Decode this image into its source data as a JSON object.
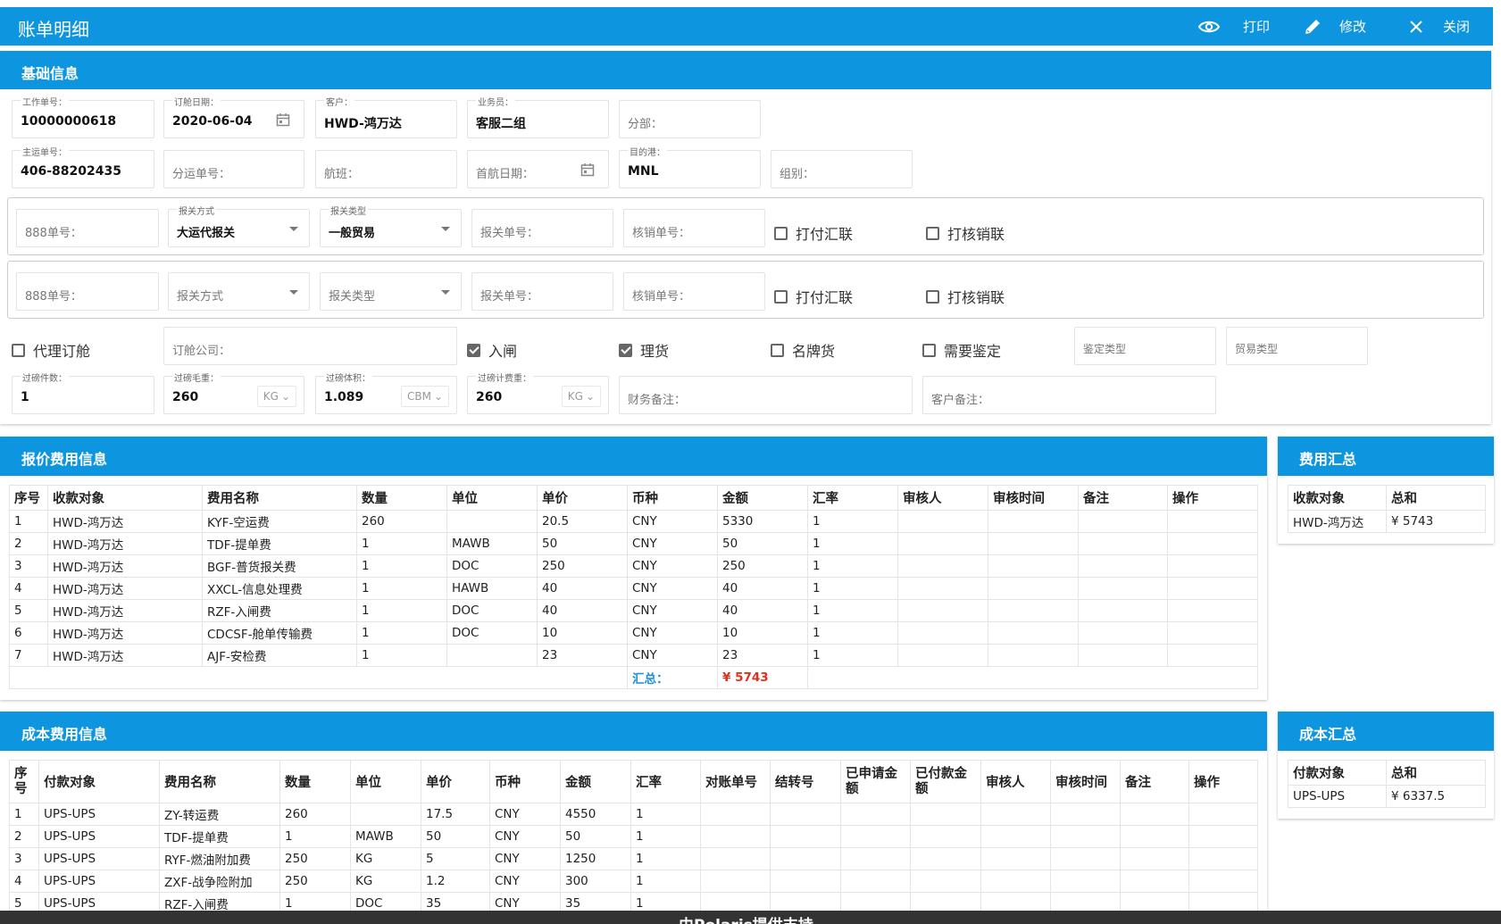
{
  "window": {
    "title": "账单明细",
    "buttons": {
      "print": "打印",
      "edit": "修改",
      "close": "关闭"
    }
  },
  "basic": {
    "heading": "基础信息",
    "work_no": {
      "label": "工作单号：",
      "value": "10000000618"
    },
    "booking_date": {
      "label": "订舱日期：",
      "value": "2020-06-04"
    },
    "customer": {
      "label": "客户：",
      "value": "HWD-鸿万达"
    },
    "salesman": {
      "label": "业务员：",
      "value": "客服二组"
    },
    "branch": {
      "placeholder": "分部："
    },
    "master_no": {
      "label": "主运单号：",
      "value": "406-88202435"
    },
    "sub_no": {
      "placeholder": "分运单号："
    },
    "flight": {
      "placeholder": "航班："
    },
    "first_flight_date": {
      "placeholder": "首航日期："
    },
    "destination": {
      "label": "目的港：",
      "value": "MNL"
    },
    "group": {
      "placeholder": "组别："
    },
    "customs_rows": [
      {
        "no888": "888单号：",
        "method_label": "报关方式",
        "method": "大运代报关",
        "type_label": "报关类型",
        "type": "一般贸易",
        "decl_no": "报关单号：",
        "verify_no": "核销单号：",
        "print_pay": "打付汇联",
        "print_verify": "打核销联"
      },
      {
        "no888": "888单号：",
        "method_placeholder": "报关方式",
        "type_placeholder": "报关类型",
        "decl_no": "报关单号：",
        "verify_no": "核销单号：",
        "print_pay": "打付汇联",
        "print_verify": "打核销联"
      }
    ],
    "agent_booking": "代理订舱",
    "booking_company": "订舱公司：",
    "gate_in": "入闸",
    "sorting": "理货",
    "brand_goods": "名牌货",
    "need_inspection": "需要鉴定",
    "inspection_type": "鉴定类型",
    "trade_type": "贸易类型",
    "pieces": {
      "label": "过磅件数：",
      "value": "1"
    },
    "gross_weight": {
      "label": "过磅毛重：",
      "value": "260",
      "unit": "KG"
    },
    "volume": {
      "label": "过磅体积：",
      "value": "1.089",
      "unit": "CBM"
    },
    "charge_weight": {
      "label": "过磅计费重：",
      "value": "260",
      "unit": "KG"
    },
    "finance_note": "财务备注：",
    "customer_note": "客户备注："
  },
  "quote": {
    "heading": "报价费用信息",
    "columns": [
      "序号",
      "收款对象",
      "费用名称",
      "数量",
      "单位",
      "单价",
      "币种",
      "金额",
      "汇率",
      "审核人",
      "审核时间",
      "备注",
      "操作"
    ],
    "rows": [
      [
        "1",
        "HWD-鸿万达",
        "KYF-空运费",
        "260",
        "",
        "20.5",
        "CNY",
        "5330",
        "1",
        "",
        "",
        "",
        ""
      ],
      [
        "2",
        "HWD-鸿万达",
        "TDF-提单费",
        "1",
        "MAWB",
        "50",
        "CNY",
        "50",
        "1",
        "",
        "",
        "",
        ""
      ],
      [
        "3",
        "HWD-鸿万达",
        "BGF-普货报关费",
        "1",
        "DOC",
        "250",
        "CNY",
        "250",
        "1",
        "",
        "",
        "",
        ""
      ],
      [
        "4",
        "HWD-鸿万达",
        "XXCL-信息处理费",
        "1",
        "HAWB",
        "40",
        "CNY",
        "40",
        "1",
        "",
        "",
        "",
        ""
      ],
      [
        "5",
        "HWD-鸿万达",
        "RZF-入闸费",
        "1",
        "DOC",
        "40",
        "CNY",
        "40",
        "1",
        "",
        "",
        "",
        ""
      ],
      [
        "6",
        "HWD-鸿万达",
        "CDCSF-舱单传输费",
        "1",
        "DOC",
        "10",
        "CNY",
        "10",
        "1",
        "",
        "",
        "",
        ""
      ],
      [
        "7",
        "HWD-鸿万达",
        "AJF-安检费",
        "1",
        "",
        "23",
        "CNY",
        "23",
        "1",
        "",
        "",
        "",
        ""
      ]
    ],
    "total_label": "汇总：",
    "total_value": "¥ 5743"
  },
  "fee_summary": {
    "heading": "费用汇总",
    "columns": [
      "收款对象",
      "总和"
    ],
    "rows": [
      [
        "HWD-鸿万达",
        "¥ 5743"
      ]
    ]
  },
  "cost": {
    "heading": "成本费用信息",
    "columns": [
      "序号",
      "付款对象",
      "费用名称",
      "数量",
      "单位",
      "单价",
      "币种",
      "金额",
      "汇率",
      "对账单号",
      "结转号",
      "已申请金额",
      "已付款金额",
      "审核人",
      "审核时间",
      "备注",
      "操作"
    ],
    "rows": [
      [
        "1",
        "UPS-UPS",
        "ZY-转运费",
        "260",
        "",
        "17.5",
        "CNY",
        "4550",
        "1"
      ],
      [
        "2",
        "UPS-UPS",
        "TDF-提单费",
        "1",
        "MAWB",
        "50",
        "CNY",
        "50",
        "1"
      ],
      [
        "3",
        "UPS-UPS",
        "RYF-燃油附加费",
        "250",
        "KG",
        "5",
        "CNY",
        "1250",
        "1"
      ],
      [
        "4",
        "UPS-UPS",
        "ZXF-战争险附加",
        "250",
        "KG",
        "1.2",
        "CNY",
        "300",
        "1"
      ],
      [
        "5",
        "UPS-UPS",
        "RZF-入闸费",
        "1",
        "DOC",
        "35",
        "CNY",
        "35",
        "1"
      ]
    ]
  },
  "cost_summary": {
    "heading": "成本汇总",
    "columns": [
      "付款对象",
      "总和"
    ],
    "rows": [
      [
        "UPS-UPS",
        "¥ 6337.5"
      ]
    ]
  },
  "footer": {
    "text": "由Polaris提供支持"
  }
}
